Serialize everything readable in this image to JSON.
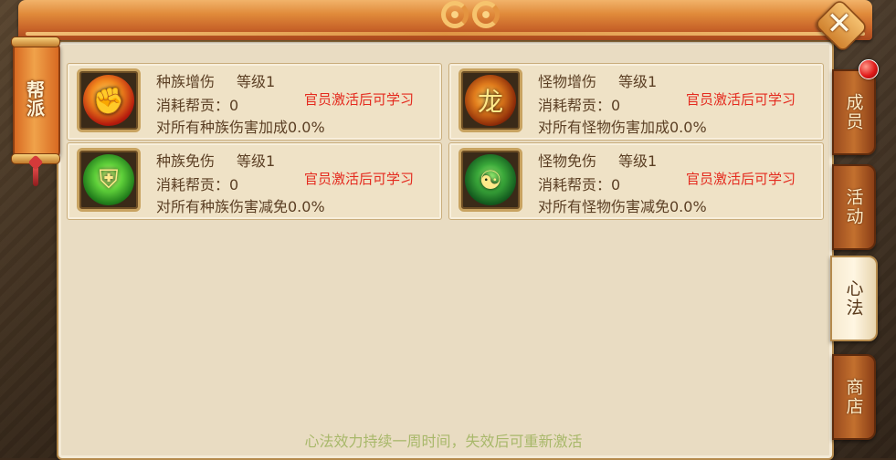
{
  "window": {
    "title": "帮派",
    "close_glyph": "✕"
  },
  "skills": [
    {
      "icon": "fist-icon",
      "icon_glyph": "✊",
      "name": "种族增伤",
      "level": "等级1",
      "cost": "消耗帮贡：0",
      "requirement": "官员激活后可学习",
      "effect": "对所有种族伤害加成0.0%"
    },
    {
      "icon": "golden-dragon-icon",
      "icon_glyph": "龙",
      "name": "怪物增伤",
      "level": "等级1",
      "cost": "消耗帮贡：0",
      "requirement": "官员激活后可学习",
      "effect": "对所有怪物伤害加成0.0%"
    },
    {
      "icon": "shield-icon",
      "icon_glyph": "⛨",
      "name": "种族免伤",
      "level": "等级1",
      "cost": "消耗帮贡：0",
      "requirement": "官员激活后可学习",
      "effect": "对所有种族伤害减免0.0%"
    },
    {
      "icon": "green-spirit-icon",
      "icon_glyph": "☯",
      "name": "怪物免伤",
      "level": "等级1",
      "cost": "消耗帮贡：0",
      "requirement": "官员激活后可学习",
      "effect": "对所有怪物伤害减免0.0%"
    }
  ],
  "footer_note": "心法效力持续一周时间，失效后可重新激活",
  "tabs": [
    {
      "label": "成员",
      "active": false,
      "notification": true
    },
    {
      "label": "活动",
      "active": false,
      "notification": false
    },
    {
      "label": "心法",
      "active": true,
      "notification": false
    },
    {
      "label": "商店",
      "active": false,
      "notification": false
    }
  ],
  "colors": {
    "requirement_red": "#e42a1e",
    "body_text": "#5b3f24",
    "footer_green": "#a8b86a",
    "panel_bg": "#e9dcc2",
    "tab_orange": "#c3702e"
  }
}
